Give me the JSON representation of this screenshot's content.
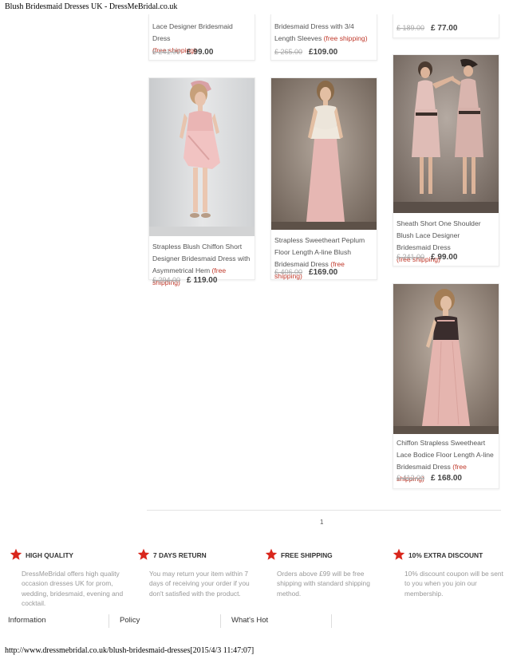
{
  "print_header": "Blush Bridesmaid Dresses UK - DressMeBridal.co.uk",
  "print_footer": "http://www.dressmebridal.co.uk/blush-bridesmaid-dresses[2015/4/3 11:47:07]",
  "products_top": [
    {
      "name": "Lace Designer Bridesmaid Dress",
      "shipping": "(free shipping)",
      "old_price": "£ 241.00",
      "new_price": "£ 99.00"
    },
    {
      "name": "Bridesmaid Dress with 3/4 Length Sleeves",
      "shipping": "(free shipping)",
      "old_price": "£ 265.00",
      "new_price": "£109.00"
    },
    {
      "name": "",
      "shipping": "",
      "old_price": "£ 189.00",
      "new_price": "£ 77.00"
    }
  ],
  "products": [
    {
      "name": "Strapless Blush Chiffon Short Designer Bridesmaid Dress with Asymmetrical Hem",
      "shipping": "(free shipping)",
      "old_price": "£ 294.00",
      "new_price": "£ 119.00",
      "image_icon": "dress-photo-short-chiffon"
    },
    {
      "name": "Strapless Sweetheart Peplum Floor Length A-line Blush Bridesmaid Dress",
      "shipping": "(free shipping)",
      "old_price": "£ 406.00",
      "new_price": "£169.00",
      "image_icon": "dress-photo-peplum-floor"
    },
    {
      "name": "Sheath Short One Shoulder Blush Lace Designer Bridesmaid Dress",
      "shipping": "(free shipping)",
      "old_price": "£ 241.00",
      "new_price": "£ 99.00",
      "image_icon": "dress-photo-two-lace-dresses"
    },
    {
      "name": "Chiffon Strapless Sweetheart Lace Bodice Floor Length A-line Bridesmaid Dress",
      "shipping": "(free shipping)",
      "old_price": "£ 412.00",
      "new_price": "£ 168.00",
      "image_icon": "dress-photo-lace-bodice-gown"
    }
  ],
  "pagination": {
    "current_page": "1"
  },
  "features": [
    {
      "title": "HIGH QUALITY",
      "desc": "DressMeBridal offers high quality occasion dresses UK for prom, wedding, bridesmaid, evening and cocktail.",
      "icon": "red-star-icon"
    },
    {
      "title": "7 DAYS RETURN",
      "desc": "You may return your item within 7 days of receiving your order if you don't satisfied with the product.",
      "icon": "red-star-icon"
    },
    {
      "title": "FREE SHIPPING",
      "desc": "Orders above £99 will be free shipping with standard shipping method.",
      "icon": "red-star-icon"
    },
    {
      "title": "10% EXTRA DISCOUNT",
      "desc": "10% discount coupon will be sent to you when you join our membership.",
      "icon": "red-star-icon"
    }
  ],
  "bottom_nav": {
    "items": [
      "Information",
      "Policy",
      "What's Hot"
    ]
  },
  "colors": {
    "accent_red": "#c0392b",
    "star_red": "#d9261c",
    "text_muted": "#999999"
  }
}
